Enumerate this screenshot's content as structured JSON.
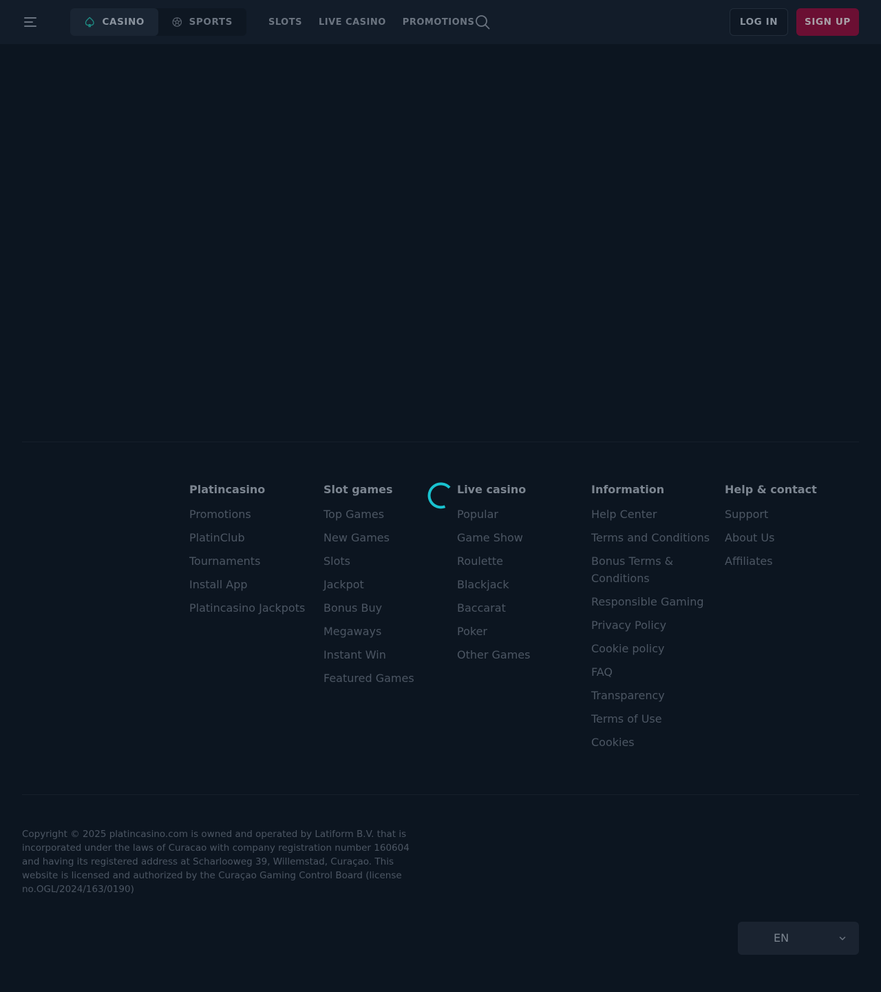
{
  "header": {
    "product_tabs": [
      {
        "label": "CASINO",
        "icon": "spade-icon",
        "active": true
      },
      {
        "label": "SPORTS",
        "icon": "soccer-ball-icon",
        "active": false
      }
    ],
    "nav": [
      "SLOTS",
      "LIVE CASINO",
      "PROMOTIONS"
    ],
    "login_label": "LOG IN",
    "signup_label": "SIGN UP"
  },
  "colors": {
    "background": "#0c1520",
    "header": "#121c29",
    "accent_spinner": "#19c2cf",
    "signup": "#6b0f33"
  },
  "footer": {
    "columns": [
      {
        "title": "Platincasino",
        "items": [
          "Promotions",
          "PlatinClub",
          "Tournaments",
          "Install App",
          "Platincasino Jackpots"
        ]
      },
      {
        "title": "Slot games",
        "items": [
          "Top Games",
          "New Games",
          "Slots",
          "Jackpot",
          "Bonus Buy",
          "Megaways",
          "Instant Win",
          "Featured Games"
        ]
      },
      {
        "title": "Live casino",
        "items": [
          "Popular",
          "Game Show",
          "Roulette",
          "Blackjack",
          "Baccarat",
          "Poker",
          "Other Games"
        ]
      },
      {
        "title": "Information",
        "items": [
          "Help Center",
          "Terms and Conditions",
          "Bonus Terms & Conditions",
          "Responsible Gaming",
          "Privacy Policy",
          "Cookie policy",
          "FAQ",
          "Transparency",
          "Terms of Use",
          "Cookies"
        ]
      },
      {
        "title": "Help & contact",
        "items": [
          "Support",
          "About Us",
          "Affiliates"
        ]
      }
    ],
    "copyright": "Copyright © 2025 platincasino.com is owned and operated by Latiform B.V. that is incorporated under the laws of Curacao with company registration number 160604 and having its registered address at Scharlooweg 39, Willemstad, Curaçao. This website is licensed and authorized by the Curaçao Gaming Control Board (license no.OGL/2024/163/0190)",
    "language": "EN"
  }
}
